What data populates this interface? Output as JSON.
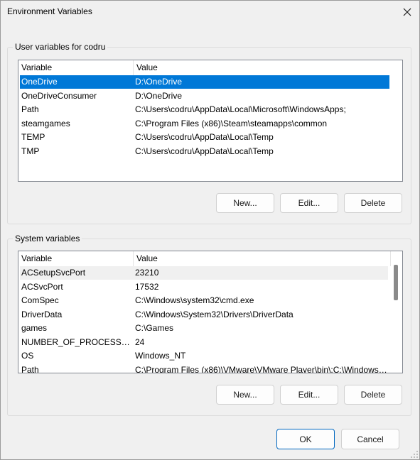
{
  "window": {
    "title": "Environment Variables"
  },
  "user_group": {
    "label": "User variables for codru",
    "columns": [
      "Variable",
      "Value"
    ],
    "rows": [
      {
        "variable": "OneDrive",
        "value": "D:\\OneDrive",
        "selected": true
      },
      {
        "variable": "OneDriveConsumer",
        "value": "D:\\OneDrive"
      },
      {
        "variable": "Path",
        "value": "C:\\Users\\codru\\AppData\\Local\\Microsoft\\WindowsApps;"
      },
      {
        "variable": "steamgames",
        "value": "C:\\Program Files (x86)\\Steam\\steamapps\\common"
      },
      {
        "variable": "TEMP",
        "value": "C:\\Users\\codru\\AppData\\Local\\Temp"
      },
      {
        "variable": "TMP",
        "value": "C:\\Users\\codru\\AppData\\Local\\Temp"
      }
    ],
    "buttons": {
      "new": "New...",
      "edit": "Edit...",
      "delete": "Delete"
    }
  },
  "system_group": {
    "label": "System variables",
    "columns": [
      "Variable",
      "Value"
    ],
    "rows": [
      {
        "variable": "ACSetupSvcPort",
        "value": "23210",
        "hover": true
      },
      {
        "variable": "ACSvcPort",
        "value": "17532"
      },
      {
        "variable": "ComSpec",
        "value": "C:\\Windows\\system32\\cmd.exe"
      },
      {
        "variable": "DriverData",
        "value": "C:\\Windows\\System32\\Drivers\\DriverData"
      },
      {
        "variable": "games",
        "value": "C:\\Games"
      },
      {
        "variable": "NUMBER_OF_PROCESSORS",
        "value": "24"
      },
      {
        "variable": "OS",
        "value": "Windows_NT"
      },
      {
        "variable": "Path",
        "value": "C:\\Program Files (x86)\\VMware\\VMware Player\\bin\\;C:\\Windows\\..."
      }
    ],
    "buttons": {
      "new": "New...",
      "edit": "Edit...",
      "delete": "Delete"
    }
  },
  "footer": {
    "ok": "OK",
    "cancel": "Cancel"
  },
  "colors": {
    "selection": "#0078d7",
    "dialog_bg": "#f0f0f0",
    "default_button_border": "#0067c0"
  }
}
